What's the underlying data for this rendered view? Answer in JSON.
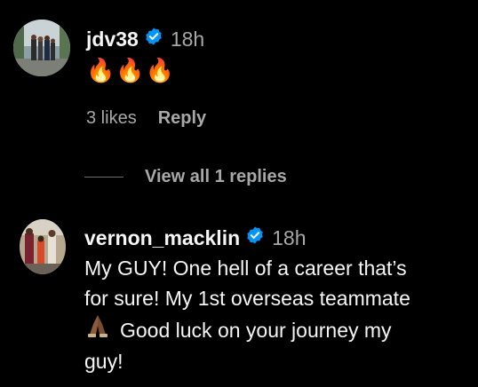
{
  "comments": [
    {
      "username": "jdv38",
      "time": "18h",
      "text": "🔥🔥🔥",
      "likes": "3 likes",
      "reply_label": "Reply",
      "view_replies": "View all 1 replies"
    },
    {
      "username": "vernon_macklin",
      "time": "18h",
      "text_line1": "My GUY! One hell of a career that’s",
      "text_line2": "for sure! My 1st overseas teammate",
      "text_line3": "Good luck on your journey my",
      "text_line4": "guy!"
    }
  ],
  "colors": {
    "background": "#000000",
    "primary_text": "#f5f5f5",
    "secondary_text": "#a8a8a8",
    "verified_blue": "#0095f6"
  },
  "icons": {
    "verified": "verified-badge-icon",
    "emoji_pray": "folded-hands-emoji"
  }
}
